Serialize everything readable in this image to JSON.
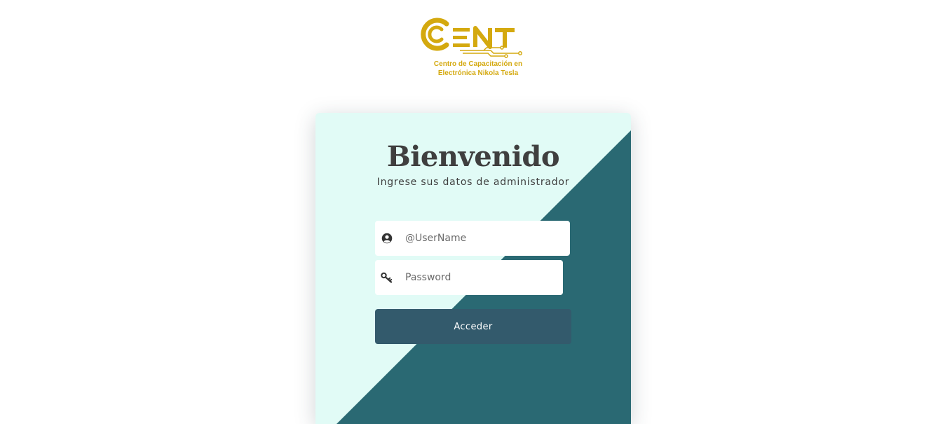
{
  "logo": {
    "text": "CENT",
    "line1": "Centro de Capacitación en",
    "line2": "Electrónica Nikola Tesla",
    "color": "#d4a90f"
  },
  "login": {
    "title": "Bienvenido",
    "subtitle": "Ingrese sus datos de administrador",
    "username": {
      "placeholder": "@UserName",
      "value": "",
      "icon": "user-circle-icon"
    },
    "password": {
      "placeholder": "Password",
      "value": "",
      "icon": "key-icon"
    },
    "submit_label": "Acceder"
  },
  "colors": {
    "card_light": "#e1fbf6",
    "card_dark": "#2a6973",
    "button": "#335a6c",
    "text": "#3f3f3f"
  }
}
